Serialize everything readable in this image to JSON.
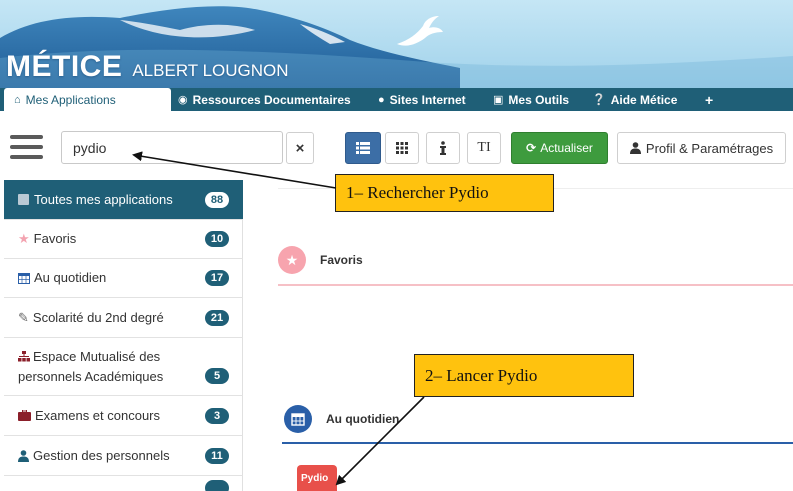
{
  "banner": {
    "brand_name": "MÉTICE",
    "school_name": "ALBERT LOUGNON",
    "colors": {
      "sky": "#a9d8ee",
      "mountain": "#2c6fa8",
      "accent": "#1f5f77"
    }
  },
  "nav": {
    "tabs": [
      {
        "label": "Mes Applications",
        "icon": "home-icon",
        "active": true
      },
      {
        "label": "Ressources Documentaires",
        "icon": "circle-target-icon"
      },
      {
        "label": "Sites Internet",
        "icon": "globe-icon"
      },
      {
        "label": "Mes Outils",
        "icon": "rss-icon"
      },
      {
        "label": "Aide Métice",
        "icon": "question-circle-icon"
      },
      {
        "label": "+",
        "icon": "plus-icon"
      }
    ]
  },
  "toolbar": {
    "search_value": "pydio",
    "clear_label": "×",
    "refresh_label": "Actualiser",
    "profile_label": "Profil & Paramétrages",
    "text_size_label": "TI"
  },
  "sidebar": {
    "items": [
      {
        "label": "Toutes mes applications",
        "count": "88",
        "icon": "square-icon",
        "active": true
      },
      {
        "label": "Favoris",
        "count": "10",
        "icon": "star-icon"
      },
      {
        "label": "Au quotidien",
        "count": "17",
        "icon": "calendar-icon"
      },
      {
        "label": "Scolarité du 2nd degré",
        "count": "21",
        "icon": "edit-icon"
      },
      {
        "label": "Espace Mutualisé des personnels Académiques",
        "count": "5",
        "icon": "sitemap-icon"
      },
      {
        "label": "Examens et concours",
        "count": "3",
        "icon": "briefcase-icon"
      },
      {
        "label": "Gestion des personnels",
        "count": "11",
        "icon": "user-icon"
      }
    ]
  },
  "main": {
    "sections": [
      {
        "title": "Favoris",
        "icon": "star-icon",
        "color": "#f7a4ae"
      },
      {
        "title": "Au quotidien",
        "icon": "calendar-icon",
        "color": "#2a5fa8"
      }
    ],
    "app_tile_label": "Pydio"
  },
  "callouts": {
    "step1": "1– Rechercher Pydio",
    "step2": "2– Lancer Pydio",
    "color": "#ffc20e"
  }
}
